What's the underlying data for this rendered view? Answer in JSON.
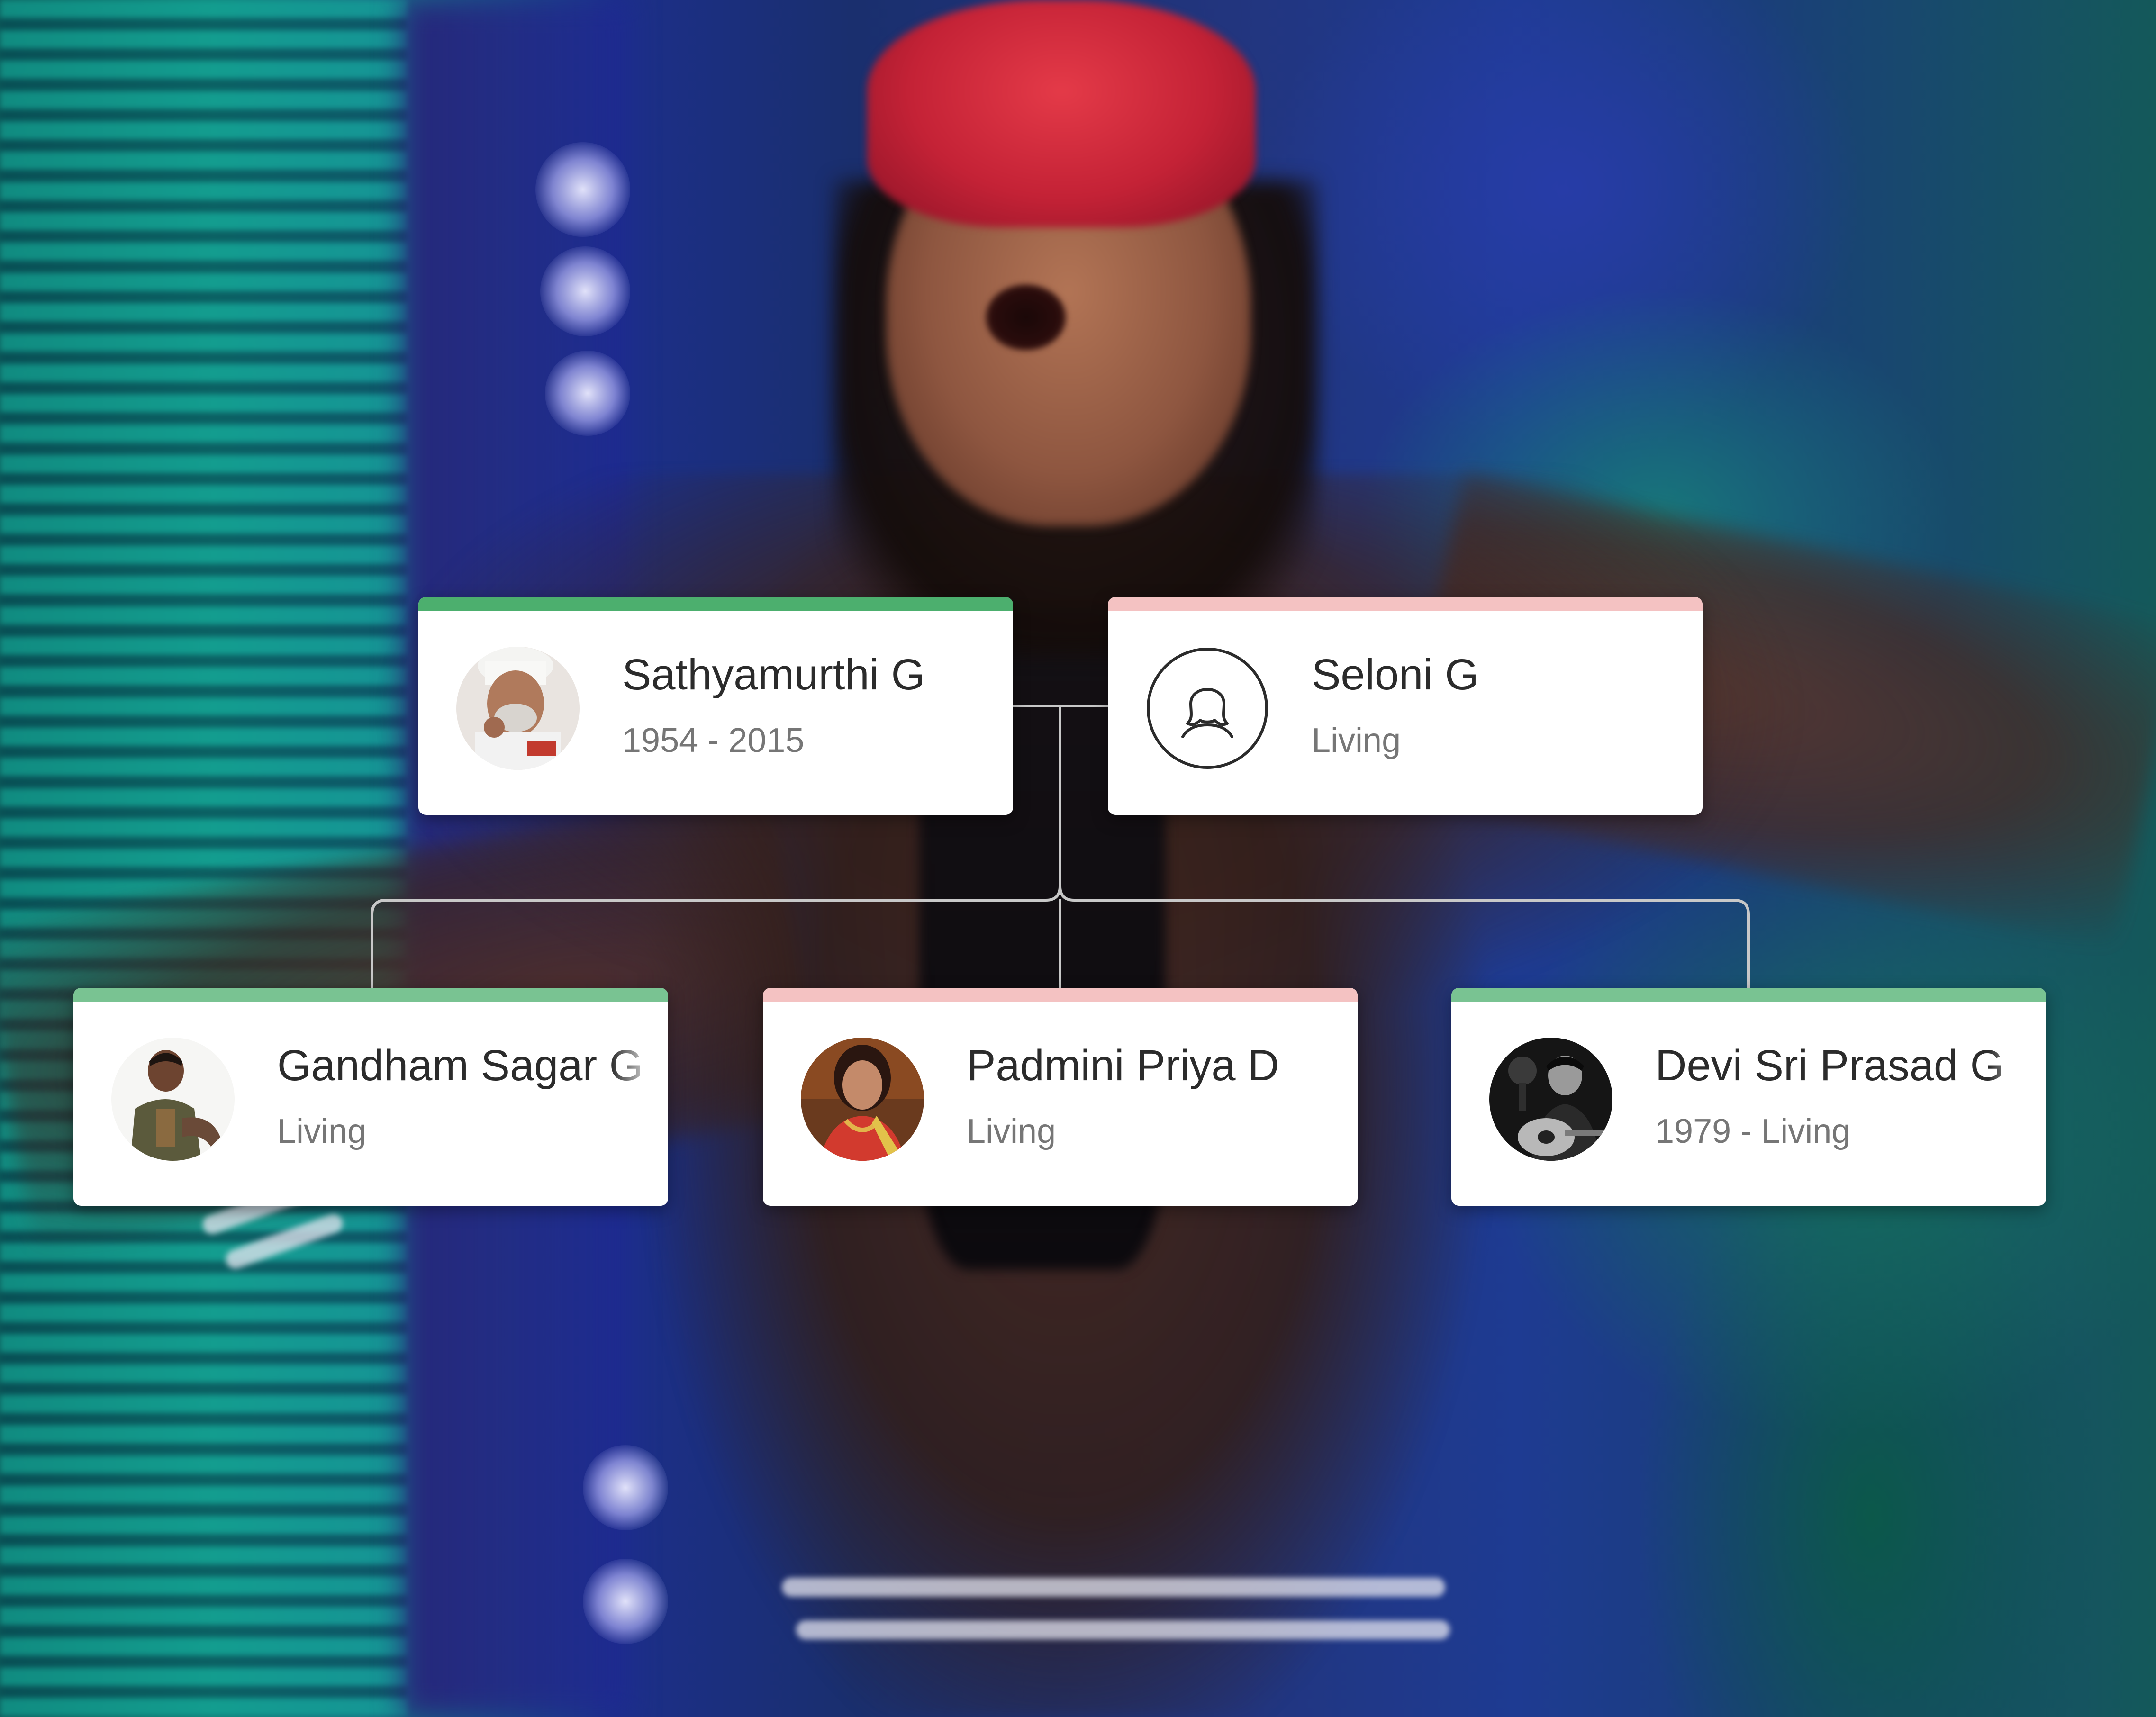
{
  "family_tree": {
    "colors": {
      "male_accent": "#4caf6e",
      "female_accent": "#f4c2c2",
      "connector": "#c8c8c8",
      "card_bg": "#ffffff",
      "name_text": "#2b2b2b",
      "dates_text": "#767676"
    },
    "parents": [
      {
        "name": "Sathyamurthi G",
        "dates": "1954 - 2015",
        "gender": "male",
        "avatar": "photo-elderly-man-white-cap"
      },
      {
        "name": "Seloni G",
        "dates": "Living",
        "gender": "female",
        "avatar": "female-placeholder-icon"
      }
    ],
    "children": [
      {
        "name": "Gandham Sagar G",
        "dates": "Living",
        "gender": "male",
        "avatar": "photo-man-sitting"
      },
      {
        "name": "Padmini Priya D",
        "dates": "Living",
        "gender": "female",
        "avatar": "photo-woman-saree"
      },
      {
        "name": "Devi Sri Prasad G",
        "dates": "1979 - Living",
        "gender": "male",
        "avatar": "photo-man-guitar-bw"
      }
    ]
  }
}
